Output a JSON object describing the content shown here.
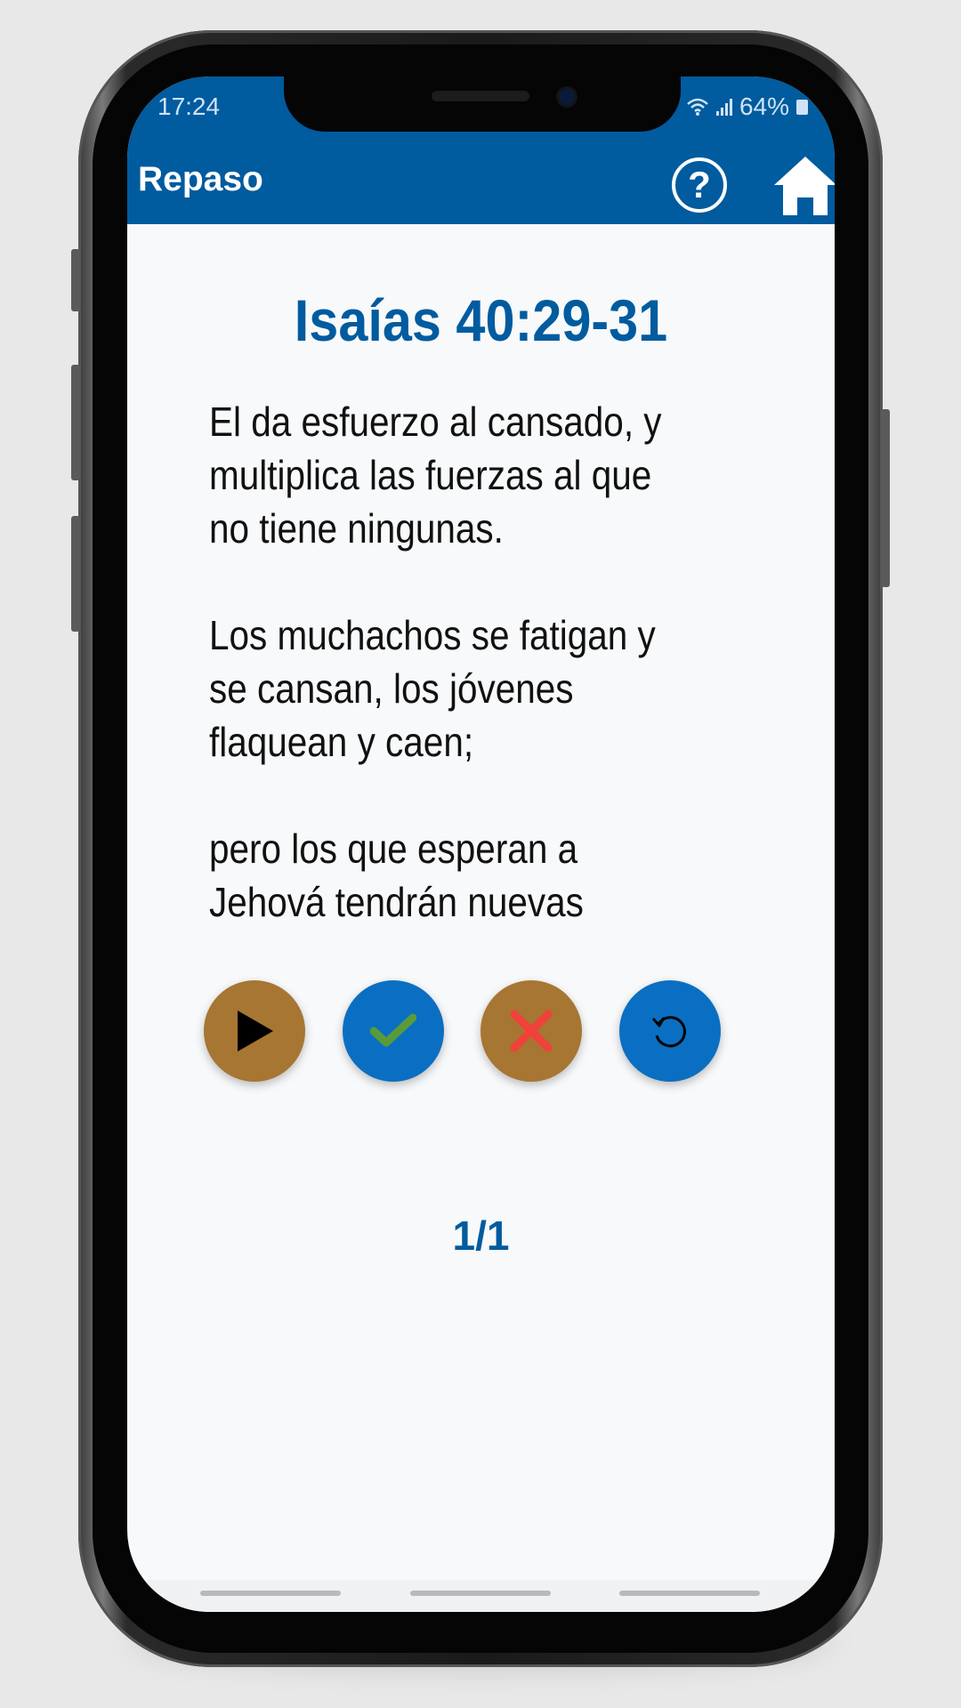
{
  "status_bar": {
    "time": "17:24",
    "battery": "64%"
  },
  "app_bar": {
    "title": "Repaso",
    "help_symbol": "?",
    "icons": [
      "help-icon",
      "home-icon"
    ]
  },
  "verse": {
    "reference": "Isaías 40:29-31",
    "paragraphs": [
      "El da esfuerzo al cansado, y multiplica las fuerzas al que no tiene ningunas.",
      "Los muchachos se fatigan y se cansan, los jóvenes flaquean y caen;",
      "pero los que esperan a Jehová tendrán nuevas"
    ]
  },
  "controls": {
    "buttons": [
      "play-icon",
      "check-icon",
      "close-icon",
      "reset-icon"
    ],
    "colors": {
      "brown": "#a67632",
      "blue": "#0a6fc2",
      "check": "#5b9a3a",
      "cross": "#f0413a"
    }
  },
  "progress": {
    "counter": "1/1"
  },
  "theme": {
    "primary": "#005b9f",
    "background": "#f8f9fa"
  }
}
